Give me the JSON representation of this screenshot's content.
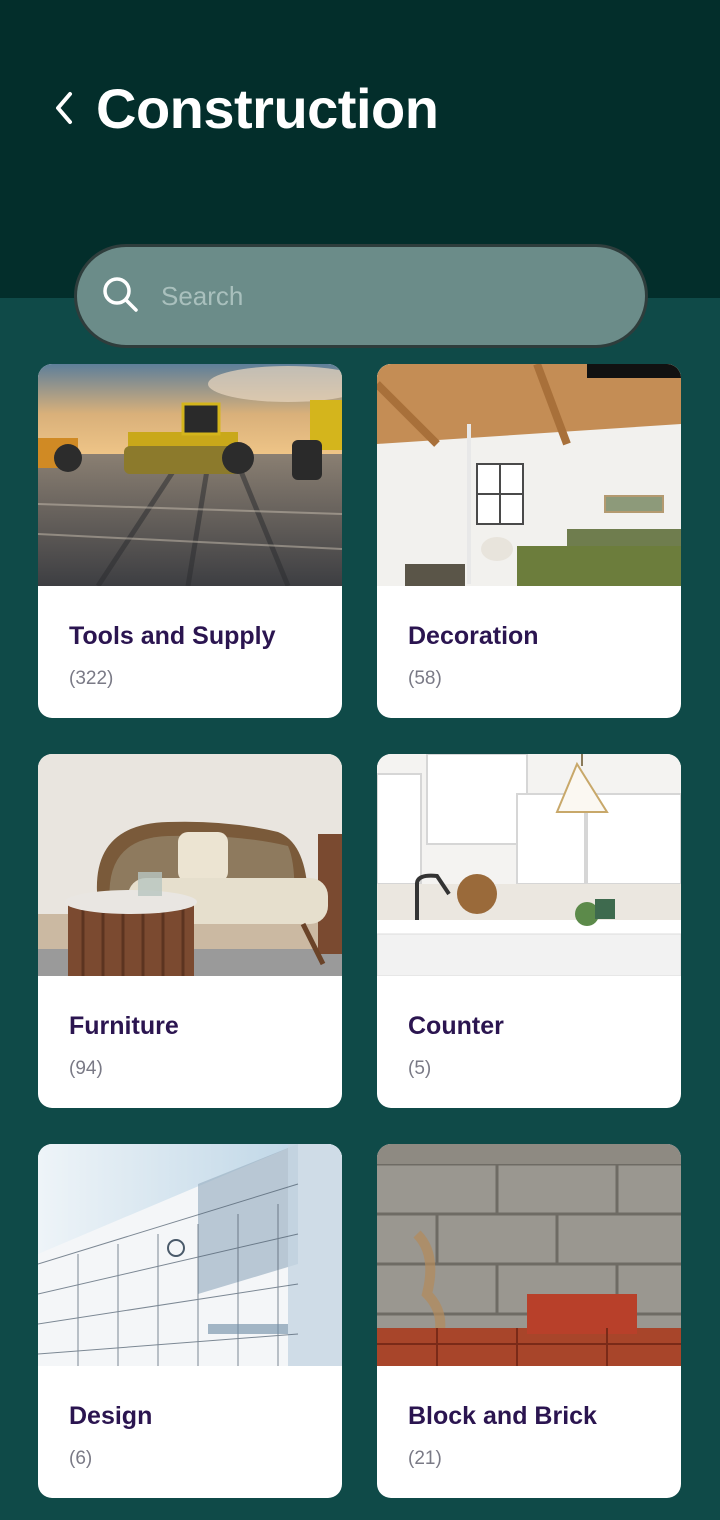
{
  "header": {
    "title": "Construction",
    "back_icon": "chevron-left-icon"
  },
  "search": {
    "placeholder": "Search",
    "value": "",
    "icon": "search-icon"
  },
  "categories": [
    {
      "name": "Tools and Supply",
      "count": "(322)",
      "image": "construction-rollers-photo"
    },
    {
      "name": "Decoration",
      "count": "(58)",
      "image": "bedroom-interior-photo"
    },
    {
      "name": "Furniture",
      "count": "(94)",
      "image": "armchair-photo"
    },
    {
      "name": "Counter",
      "count": "(5)",
      "image": "kitchen-counter-photo"
    },
    {
      "name": "Design",
      "count": "(6)",
      "image": "architecture-sketch-photo"
    },
    {
      "name": "Block and Brick",
      "count": "(21)",
      "image": "cinder-block-wall-photo"
    }
  ],
  "colors": {
    "header_bg": "#032e2b",
    "page_bg": "#0f4a48",
    "search_bg": "#6b8c89",
    "card_title": "#2b1550",
    "card_count": "#7a7a86"
  }
}
